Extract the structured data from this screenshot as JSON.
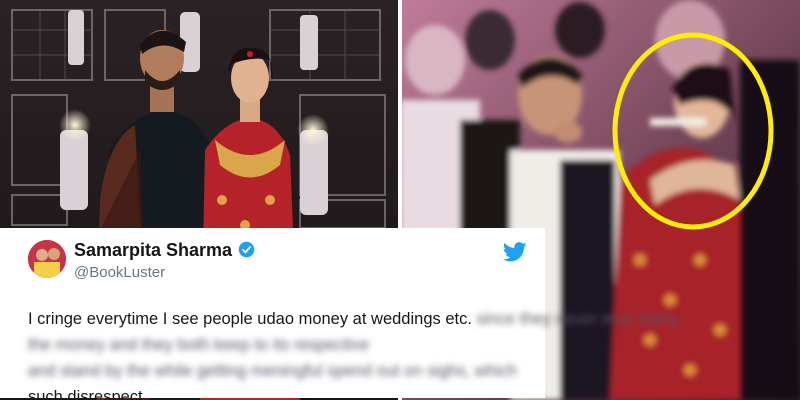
{
  "tweet": {
    "display_name": "Samarpita Sharma",
    "handle": "@BookLuster",
    "verified_icon": "verified-badge-icon",
    "platform_icon": "twitter-bird-icon",
    "text_line1": "I cringe everytime I see people udao money at weddings etc.",
    "text_line1_blurred": "since they never stop doing",
    "text_line2_blurred": "the money and they both keep to its respective",
    "text_line3_blurred": "and stand by the while getting meningful spend out on sighs, which",
    "text_line4": "such disrespect."
  },
  "colors": {
    "twitter_blue": "#1da1f2",
    "highlight_circle": "#ffee00",
    "card_bg": "#ffffff"
  }
}
